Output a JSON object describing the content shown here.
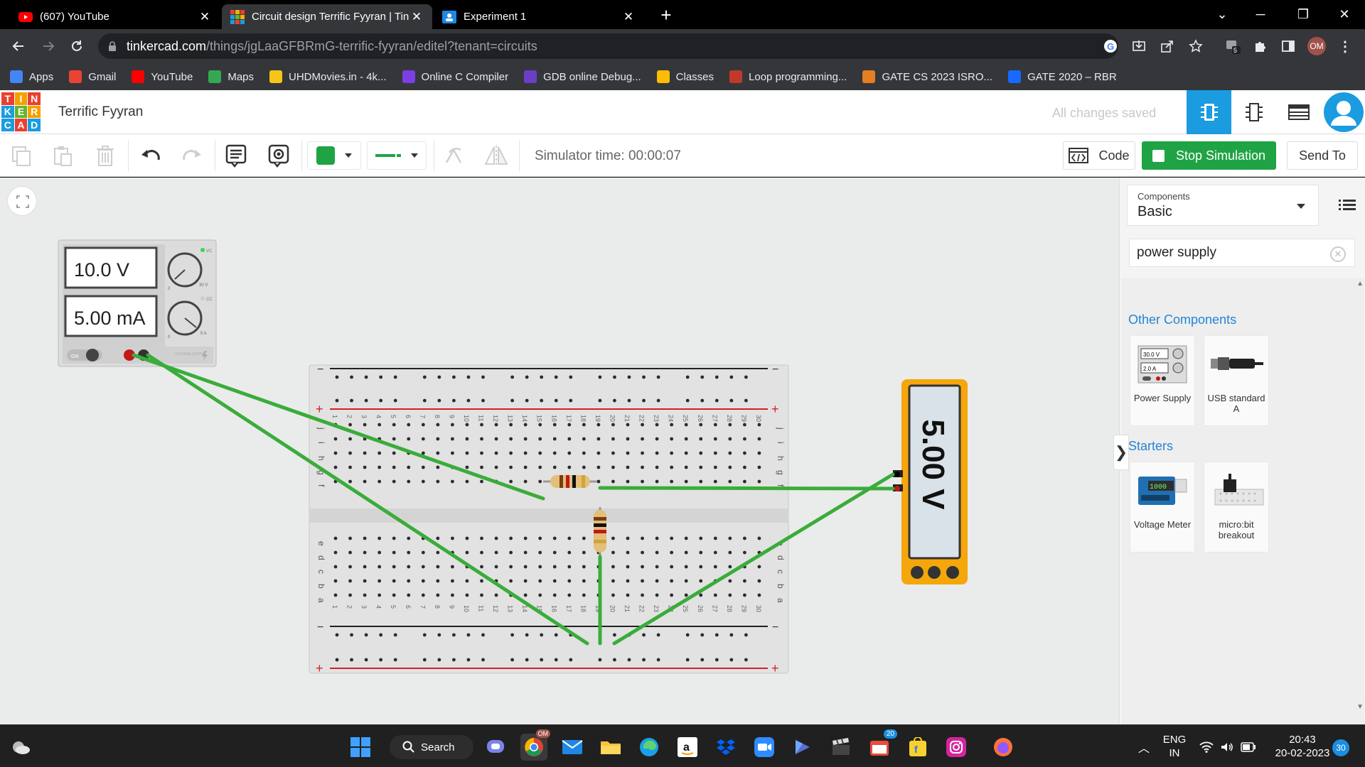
{
  "browser": {
    "tabs": [
      {
        "title": "(607) YouTube",
        "icon": "youtube-icon",
        "active": false
      },
      {
        "title": "Circuit design Terrific Fyyran | Tin",
        "icon": "tinkercad-icon",
        "active": true
      },
      {
        "title": "Experiment 1",
        "icon": "classroom-icon",
        "active": false
      }
    ],
    "url_host": "tinkercad.com",
    "url_path": "/things/jgLaaGFBRmG-terrific-fyyran/editel?tenant=circuits",
    "profile_initials": "OM",
    "extension_badge": "5",
    "bookmarks": [
      {
        "label": "Apps",
        "icon": "apps-grid-icon",
        "color": "#4285f4"
      },
      {
        "label": "Gmail",
        "icon": "google-icon",
        "color": "#ea4335"
      },
      {
        "label": "YouTube",
        "icon": "youtube-icon",
        "color": "#ff0000"
      },
      {
        "label": "Maps",
        "icon": "maps-pin-icon",
        "color": "#34a853"
      },
      {
        "label": "UHDMovies.in - 4k...",
        "icon": "uhd-icon",
        "color": "#f5c518"
      },
      {
        "label": "Online C Compiler",
        "icon": "compiler-icon",
        "color": "#7b3fe4"
      },
      {
        "label": "GDB online Debug...",
        "icon": "gdb-icon",
        "color": "#6a3fc6"
      },
      {
        "label": "Classes",
        "icon": "classroom-icon",
        "color": "#fbbc04"
      },
      {
        "label": "Loop programming...",
        "icon": "site-icon",
        "color": "#c0392b"
      },
      {
        "label": "GATE CS 2023 ISRO...",
        "icon": "site-icon",
        "color": "#e67e22"
      },
      {
        "label": "GATE 2020 – RBR",
        "icon": "behance-icon",
        "color": "#1769ff"
      }
    ]
  },
  "tinkercad": {
    "logo_letters": [
      "T",
      "I",
      "N",
      "K",
      "E",
      "R",
      "C",
      "A",
      "D"
    ],
    "project_name": "Terrific Fyyran",
    "save_status": "All changes saved",
    "simulator_time": "Simulator time: 00:00:07",
    "code_label": "Code",
    "stop_label": "Stop Simulation",
    "send_label": "Send To",
    "accent": "#1fa345",
    "power_supply": {
      "voltage": "10.0 V",
      "current": "5.00 mA",
      "on_label": "ON",
      "vc_label": "VC",
      "cc_label": "CC",
      "max_v": "30 V",
      "max_a": "5 A",
      "min_label": "0",
      "brand": "VOLTAGE SUPPLY"
    },
    "multimeter_reading": "5.00 V",
    "panel": {
      "components_label": "Components",
      "components_value": "Basic",
      "search_value": "power supply",
      "section_other": "Other Components",
      "section_starters": "Starters",
      "cards": [
        {
          "label": "Power Supply",
          "icon": "power-supply-icon",
          "mini_v": "30.0 V",
          "mini_a": "2.0 A"
        },
        {
          "label": "USB standard A",
          "icon": "usb-cable-icon"
        },
        {
          "label": "Voltage Meter",
          "icon": "arduino-voltmeter-icon",
          "mini": "1000"
        },
        {
          "label": "micro:bit breakout",
          "icon": "microbit-icon"
        }
      ]
    }
  },
  "taskbar": {
    "search_label": "Search",
    "lang_top": "ENG",
    "lang_bottom": "IN",
    "time": "20:43",
    "date": "20-02-2023",
    "notification_count": "30",
    "calendar_badge": "20",
    "chrome_badge": "OM"
  }
}
